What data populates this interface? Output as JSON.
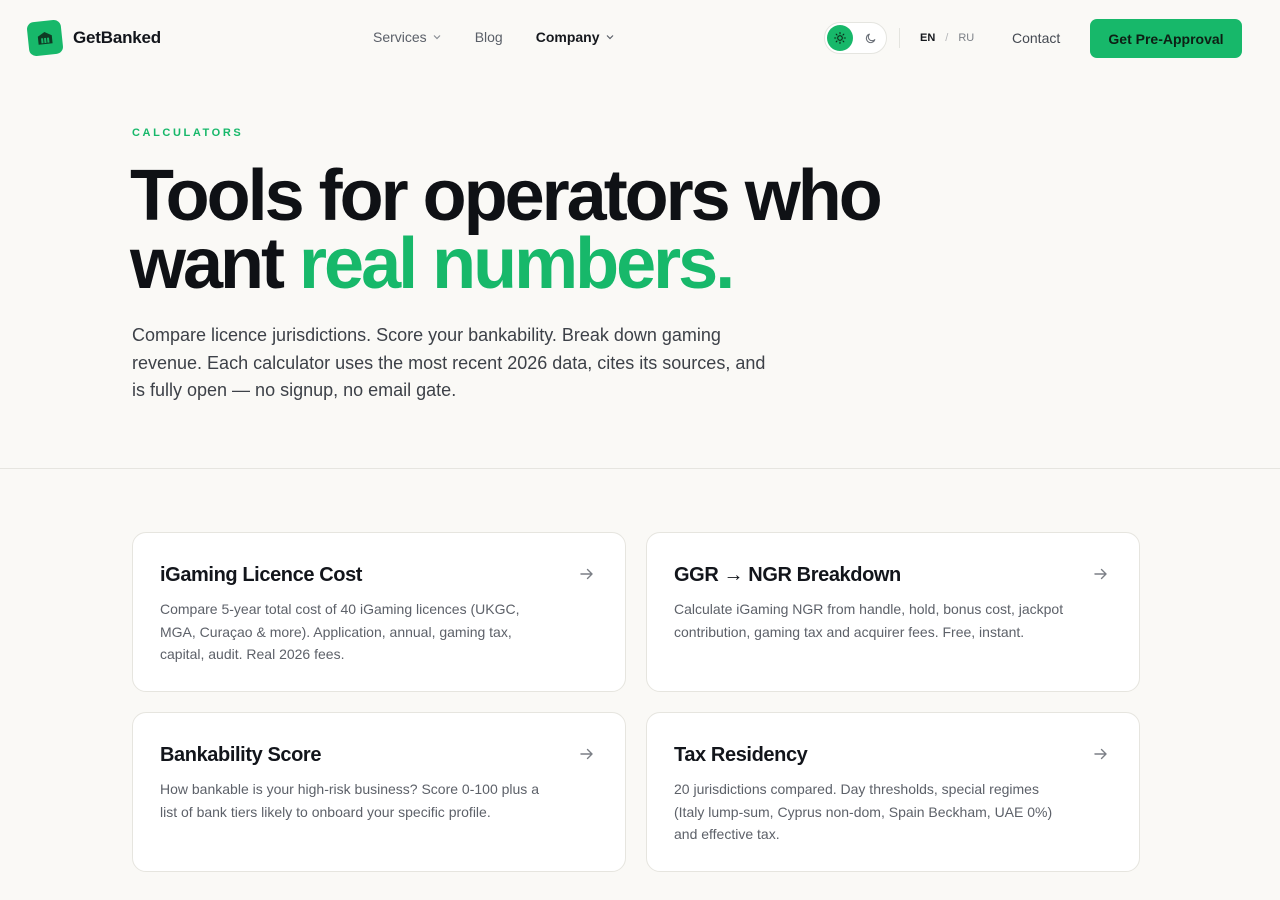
{
  "brand": {
    "name": "GetBanked",
    "accent": "#17b86a"
  },
  "nav": {
    "items": [
      {
        "label": "Services",
        "dropdown": true
      },
      {
        "label": "Blog",
        "dropdown": false
      },
      {
        "label": "Company",
        "dropdown": true
      }
    ],
    "theme": {
      "active": "light",
      "light_icon": "sun-icon",
      "dark_icon": "moon-icon"
    },
    "languages": {
      "active": "EN",
      "other": "RU",
      "separator": "/"
    },
    "contact": "Contact",
    "cta": "Get Pre-Approval"
  },
  "hero": {
    "eyebrow": "CALCULATORS",
    "title_line1": "Tools for operators who",
    "title_line2_plain": "want",
    "title_line2_accent": "real numbers.",
    "description": "Compare licence jurisdictions. Score your bankability. Break down gaming revenue. Each calculator uses the most recent 2026 data, cites its sources, and is fully open — no signup, no email gate."
  },
  "cards": [
    {
      "title": "iGaming Licence Cost",
      "description": "Compare 5-year total cost of 40 iGaming licences (UKGC, MGA, Curaçao & more). Application, annual, gaming tax, capital, audit. Real 2026 fees.",
      "icon": "arrow-right-icon"
    },
    {
      "title": "GGR → NGR Breakdown",
      "description": "Calculate iGaming NGR from handle, hold, bonus cost, jackpot contribution, gaming tax and acquirer fees. Free, instant.",
      "icon": "arrow-right-icon"
    },
    {
      "title": "Bankability Score",
      "description": "How bankable is your high-risk business? Score 0-100 plus a list of bank tiers likely to onboard your specific profile.",
      "icon": "arrow-right-icon"
    },
    {
      "title": "Tax Residency",
      "description": "20 jurisdictions compared. Day thresholds, special regimes (Italy lump-sum, Cyprus non-dom, Spain Beckham, UAE 0%) and effective tax.",
      "icon": "arrow-right-icon"
    }
  ]
}
